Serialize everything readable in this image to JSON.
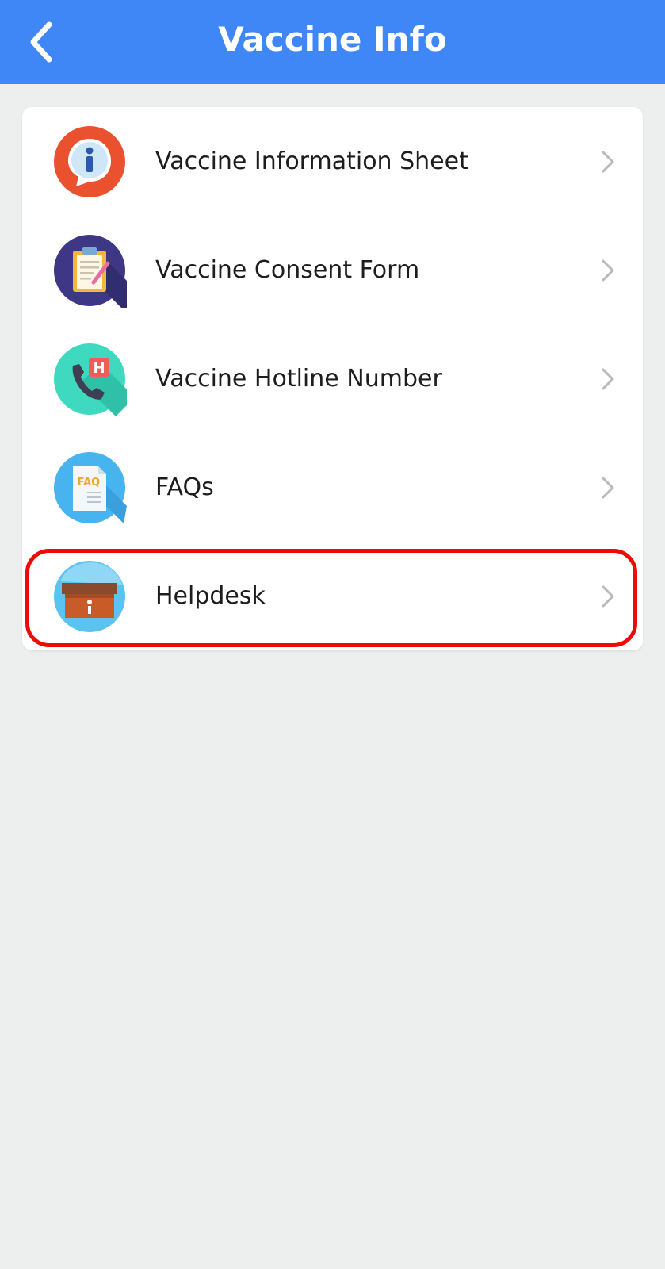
{
  "header": {
    "title": "Vaccine Info",
    "back_icon": "chevron-left-icon",
    "color": "#3f86f7"
  },
  "menu": {
    "items": [
      {
        "label": "Vaccine Information Sheet",
        "icon": "info-bubble-icon"
      },
      {
        "label": "Vaccine Consent Form",
        "icon": "clipboard-icon"
      },
      {
        "label": "Vaccine Hotline Number",
        "icon": "hospital-phone-icon"
      },
      {
        "label": "FAQs",
        "icon": "faq-document-icon",
        "icon_text": "FAQ"
      },
      {
        "label": "Helpdesk",
        "icon": "info-box-icon",
        "highlighted": true
      }
    ]
  },
  "colors": {
    "background": "#ecefee",
    "highlight": "#ef0a0a",
    "chevron": "#b9b9b9"
  }
}
